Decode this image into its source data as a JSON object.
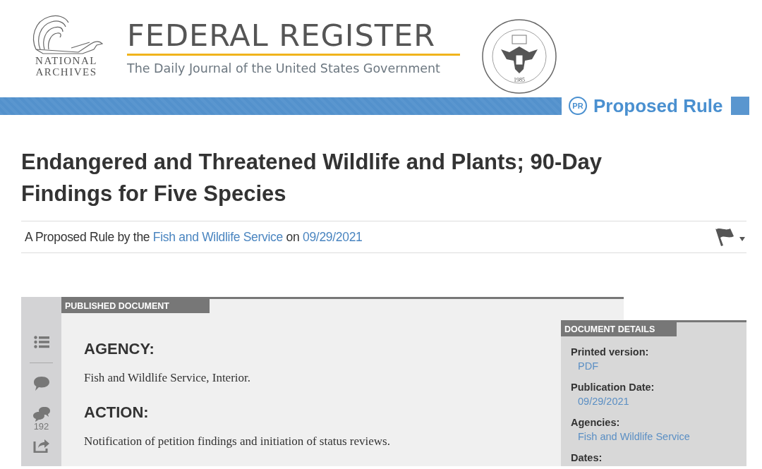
{
  "header": {
    "archives_logo": [
      "NATIONAL",
      "ARCHIVES"
    ],
    "title": "FEDERAL REGISTER",
    "tagline": "The Daily Journal of the United States Government",
    "seal_year": "1985"
  },
  "document_type": {
    "badge": "PR",
    "label": "Proposed Rule"
  },
  "title": "Endangered and Threatened Wildlife and Plants; 90-Day Findings for Five Species",
  "byline": {
    "prefix": "A Proposed Rule by the",
    "agency": "Fish and Wildlife Service",
    "joiner": "on",
    "date": "09/29/2021"
  },
  "tools": [
    {
      "kind": "contents"
    },
    {
      "kind": "divider"
    },
    {
      "kind": "comment"
    },
    {
      "kind": "comments",
      "count": "192"
    },
    {
      "kind": "share"
    }
  ],
  "document": {
    "tab": "PUBLISHED DOCUMENT",
    "sections": [
      {
        "heading": "AGENCY:",
        "text": "Fish and Wildlife Service, Interior."
      },
      {
        "heading": "ACTION:",
        "text": "Notification of petition findings and initiation of status reviews."
      }
    ]
  },
  "details": {
    "tab": "DOCUMENT DETAILS",
    "items": [
      {
        "label": "Printed version:",
        "value": "PDF"
      },
      {
        "label": "Publication Date:",
        "value": "09/29/2021"
      },
      {
        "label": "Agencies:",
        "value": "Fish and Wildlife Service"
      },
      {
        "label": "Dates:"
      }
    ]
  }
}
